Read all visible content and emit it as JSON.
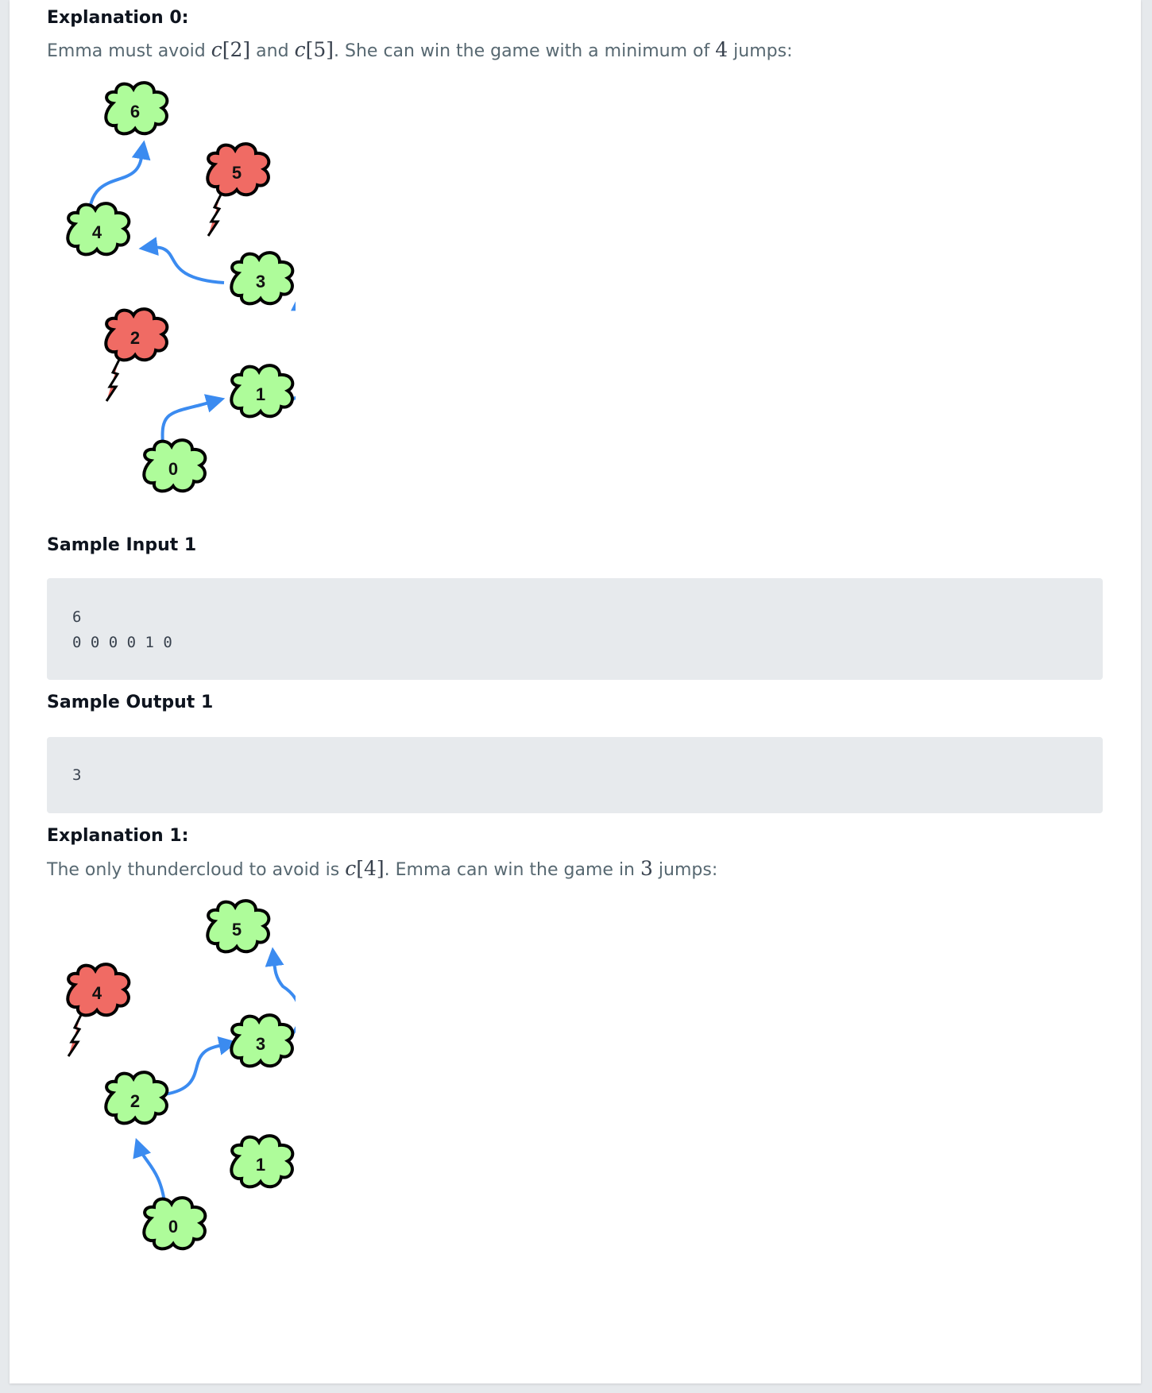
{
  "explanation0": {
    "title": "Explanation 0:",
    "text_a": "Emma must avoid ",
    "math_a": "2",
    "text_b": " and ",
    "math_b": "5",
    "text_c": ". She can win the game with a minimum of ",
    "math_c": "4",
    "text_d": " jumps:",
    "math_c_var": "c"
  },
  "figure0": {
    "clouds": [
      {
        "label": "0",
        "type": "safe"
      },
      {
        "label": "1",
        "type": "safe"
      },
      {
        "label": "2",
        "type": "thunder"
      },
      {
        "label": "3",
        "type": "safe"
      },
      {
        "label": "4",
        "type": "safe"
      },
      {
        "label": "5",
        "type": "thunder"
      },
      {
        "label": "6",
        "type": "safe"
      }
    ]
  },
  "sample_input1": {
    "title": "Sample Input 1",
    "line1": "6",
    "line2": "0 0 0 0 1 0"
  },
  "sample_output1": {
    "title": "Sample Output 1",
    "line1": "3"
  },
  "explanation1": {
    "title": "Explanation 1:",
    "text_a": "The only thundercloud to avoid is ",
    "math_a": "4",
    "text_b": ". Emma can win the game in ",
    "math_b": "3",
    "text_c": " jumps:"
  },
  "figure1": {
    "clouds": [
      {
        "label": "0",
        "type": "safe"
      },
      {
        "label": "1",
        "type": "safe"
      },
      {
        "label": "2",
        "type": "safe"
      },
      {
        "label": "3",
        "type": "safe"
      },
      {
        "label": "4",
        "type": "thunder"
      },
      {
        "label": "5",
        "type": "safe"
      }
    ]
  },
  "colors": {
    "safe_cloud": "#aefc9a",
    "thunder_cloud": "#f06b64",
    "arrow": "#3b8bf0",
    "code_bg": "#e7eaed"
  }
}
